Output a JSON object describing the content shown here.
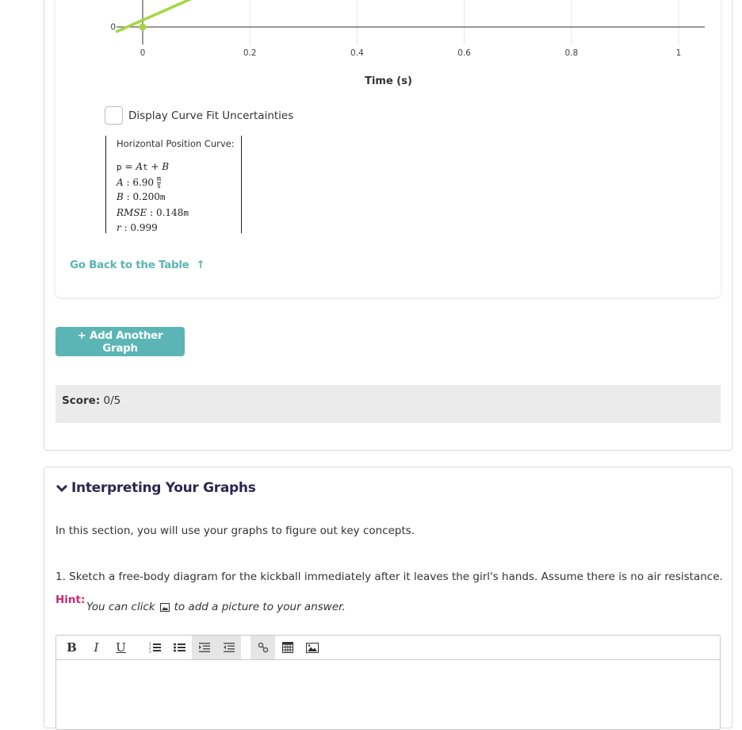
{
  "graph": {
    "x_axis_label": "Time (s)",
    "uncertainty_checkbox": {
      "label": "Display Curve Fit Uncertainties",
      "checked": false
    },
    "fit": {
      "title": "Horizontal Position Curve:",
      "equation": "p = At + B",
      "A_label": "A",
      "A_value": "6.90",
      "A_unit_num": "m",
      "A_unit_den": "s",
      "B_label": "B",
      "B_value": "0.200",
      "B_unit": "m",
      "rmse_label": "RMSE",
      "rmse_value": "0.148",
      "rmse_unit": "m",
      "r_label": "r",
      "r_value": "0.999"
    },
    "go_back_label": "Go Back to the Table",
    "go_back_icon": "arrow-up-icon"
  },
  "chart_data": {
    "type": "scatter",
    "title": "",
    "xlabel": "Time (s)",
    "ylabel": "",
    "x_ticks": [
      "0",
      "0.2",
      "0.4",
      "0.6",
      "0.8",
      "1"
    ],
    "y_ticks_visible": [
      "0"
    ],
    "xlim": [
      -0.05,
      1.05
    ],
    "grid": true,
    "series": [
      {
        "name": "data",
        "points": [
          {
            "x": 0,
            "y": 0
          }
        ],
        "color": "#a5d63f"
      },
      {
        "name": "fit",
        "kind": "line",
        "slope": 6.9,
        "intercept": 0.2,
        "color": "#a5d63f"
      }
    ]
  },
  "add_graph_label": "+ Add Another Graph",
  "score": {
    "label": "Score:",
    "value": "0/5"
  },
  "section": {
    "title": "Interpreting Your Graphs",
    "intro": "In this section, you will use your graphs to figure out key concepts.",
    "question": "1.  Sketch a free-body diagram for the kickball immediately after it leaves the girl's hands. Assume there is no air resistance.",
    "hint_label": "Hint:",
    "hint_before": "You can click",
    "hint_after": "to add a picture to your answer."
  },
  "editor": {
    "toolbar": {
      "bold": "B",
      "italic": "I",
      "underline": "U"
    },
    "content": ""
  },
  "colors": {
    "accent": "#5bb5b5",
    "hint": "#cc2a6e",
    "heading": "#2e2650",
    "fit_line": "#a5d63f"
  }
}
